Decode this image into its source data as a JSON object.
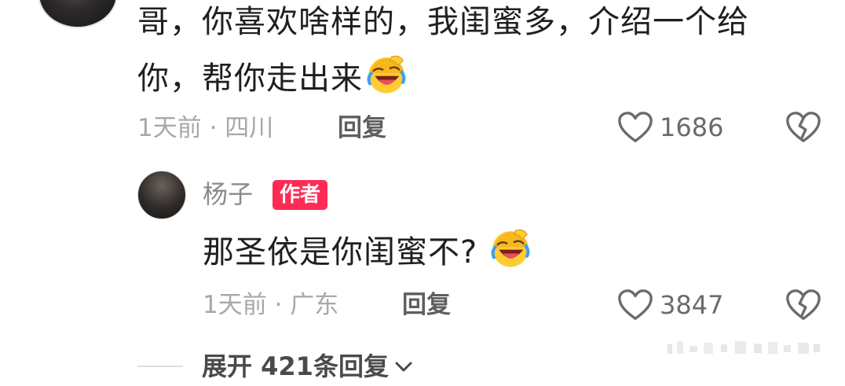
{
  "comment": {
    "text": "哥，你喜欢啥样的，我闺蜜多，介绍一个给你，帮你走出来",
    "emoji": "laughing-crying-emoji",
    "time_location": "1天前 · 四川",
    "reply_label": "回复",
    "like_count": "1686"
  },
  "reply": {
    "name": "杨子",
    "badge": "作者",
    "text": "那圣依是你闺蜜不?",
    "emoji": "laughing-crying-emoji",
    "time_location": "1天前 · 广东",
    "reply_label": "回复",
    "like_count": "3847"
  },
  "expand": {
    "label": "展开 421条回复"
  },
  "colors": {
    "badge": "#fe2c55",
    "meta_gray": "#a8a8a8",
    "text": "#1f1f1f"
  }
}
